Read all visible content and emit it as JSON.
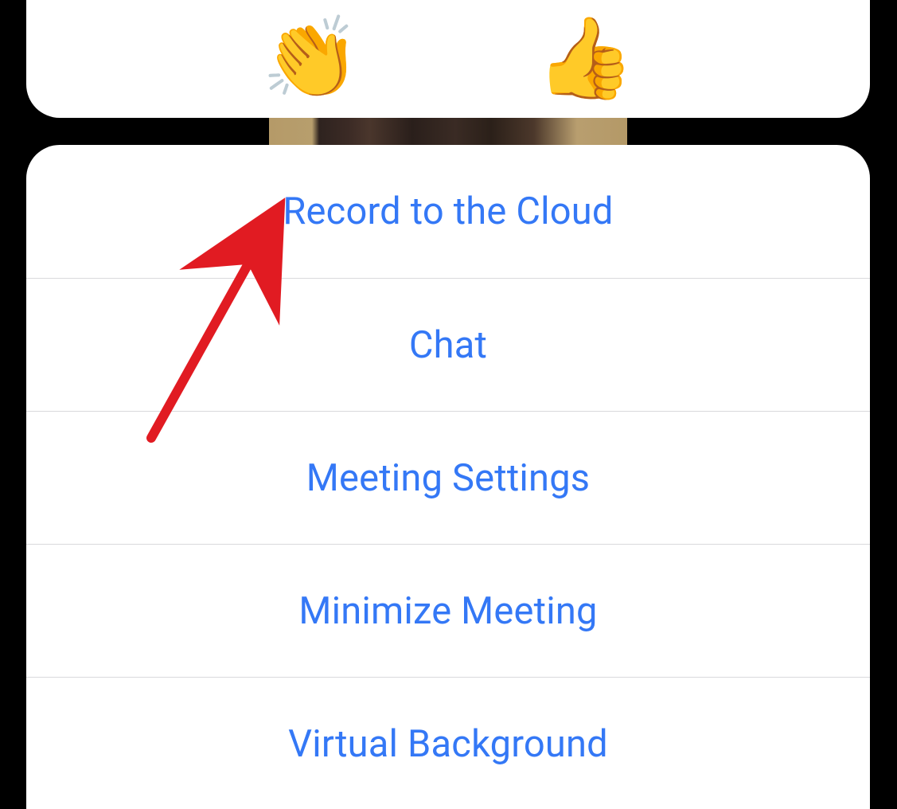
{
  "reactions": {
    "clap": "👏",
    "thumbs_up": "👍"
  },
  "menu": {
    "items": [
      {
        "label": "Record to the Cloud"
      },
      {
        "label": "Chat"
      },
      {
        "label": "Meeting Settings"
      },
      {
        "label": "Minimize Meeting"
      },
      {
        "label": "Virtual Background"
      }
    ]
  },
  "colors": {
    "link": "#3478F6",
    "annotation": "#E11B22"
  }
}
